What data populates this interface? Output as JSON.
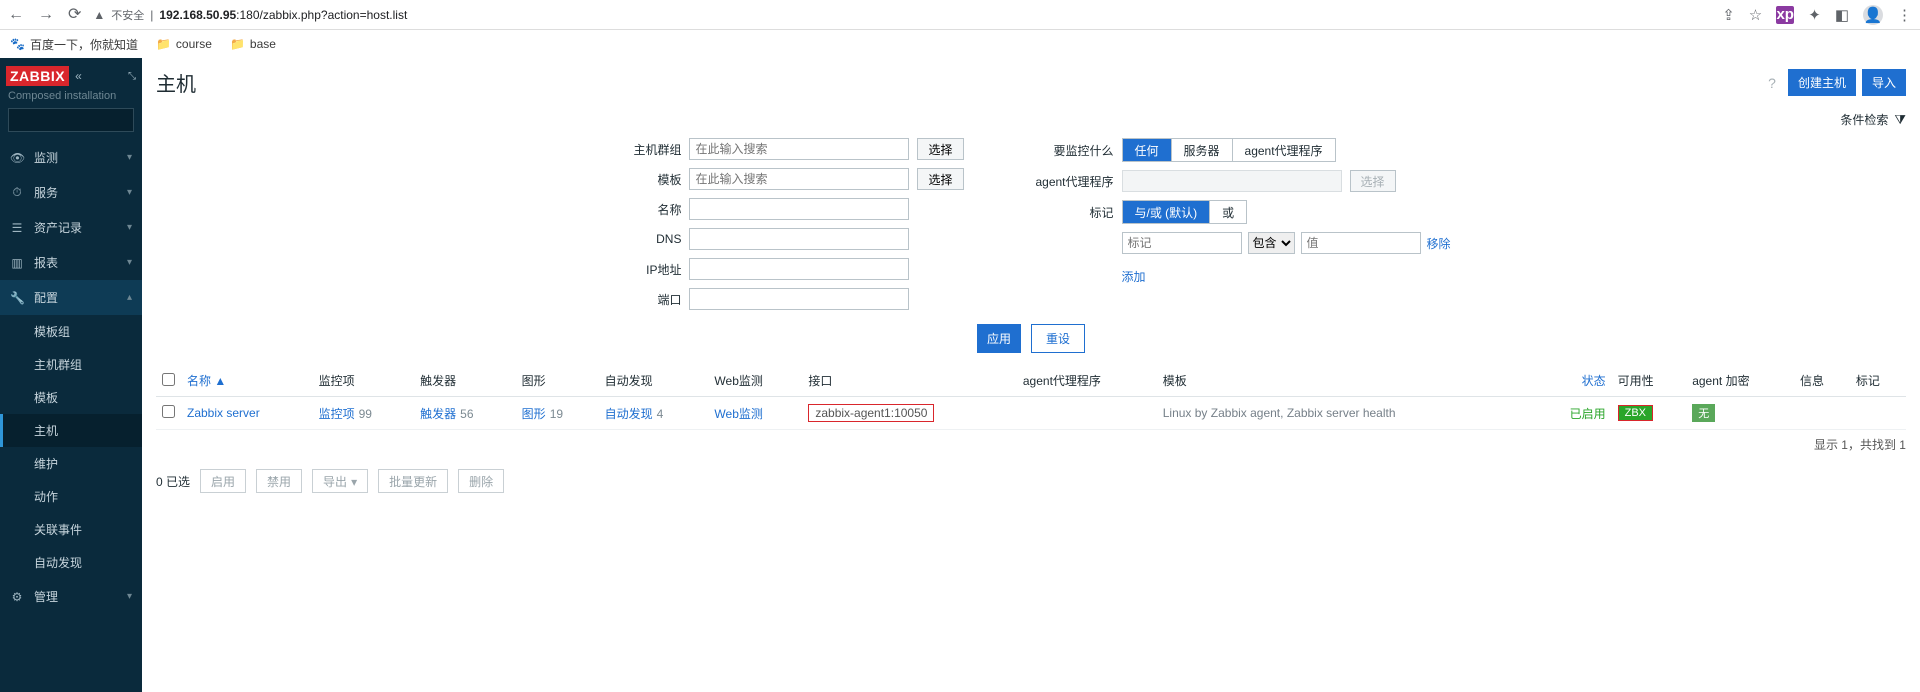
{
  "browser": {
    "insecure": "不安全",
    "url_host": "192.168.50.95",
    "url_rest": ":180/zabbix.php?action=host.list"
  },
  "bookmarks": {
    "baidu": "百度一下，你就知道",
    "course": "course",
    "base": "base"
  },
  "sidebar": {
    "logo": "ZABBIX",
    "installed": "Composed installation",
    "items": {
      "monitor": "监测",
      "services": "服务",
      "inventory": "资产记录",
      "reports": "报表",
      "config": "配置",
      "admin": "管理"
    },
    "config_sub": {
      "template_groups": "模板组",
      "host_groups": "主机群组",
      "templates": "模板",
      "hosts": "主机",
      "maintenance": "维护",
      "actions": "动作",
      "correlation": "关联事件",
      "discovery": "自动发现"
    }
  },
  "page": {
    "title": "主机",
    "create": "创建主机",
    "import": "导入",
    "filter_label": "条件检索"
  },
  "filter": {
    "left": {
      "host_group": "主机群组",
      "placeholder_search": "在此输入搜索",
      "select": "选择",
      "template": "模板",
      "name": "名称",
      "dns": "DNS",
      "ip": "IP地址",
      "port": "端口"
    },
    "right": {
      "monitor_what": "要监控什么",
      "any": "任何",
      "server": "服务器",
      "proxy": "agent代理程序",
      "proxy_label": "agent代理程序",
      "tag_label": "标记",
      "tag_andor": "与/或  (默认)",
      "tag_or": "或",
      "tag_placeholder": "标记",
      "contains": "包含",
      "value_placeholder": "值",
      "remove": "移除",
      "add": "添加"
    },
    "apply": "应用",
    "reset": "重设"
  },
  "table": {
    "headers": {
      "name": "名称",
      "items": "监控项",
      "triggers": "触发器",
      "graphs": "图形",
      "discovery": "自动发现",
      "web": "Web监测",
      "interface": "接口",
      "proxy": "agent代理程序",
      "template": "模板",
      "status": "状态",
      "availability": "可用性",
      "encryption": "agent 加密",
      "info": "信息",
      "tags": "标记"
    },
    "row": {
      "name": "Zabbix server",
      "items_label": "监控项",
      "items_count": "99",
      "triggers_label": "触发器",
      "triggers_count": "56",
      "graphs_label": "图形",
      "graphs_count": "19",
      "discovery_label": "自动发现",
      "discovery_count": "4",
      "web_label": "Web监测",
      "interface": "zabbix-agent1:10050",
      "templates": "Linux by Zabbix agent, Zabbix server health",
      "status": "已启用",
      "availability": "ZBX",
      "encryption": "无"
    },
    "paging": "显示 1，共找到 1"
  },
  "bulk": {
    "selected": "0 已选",
    "enable": "启用",
    "disable": "禁用",
    "export": "导出",
    "massupdate": "批量更新",
    "delete": "删除"
  }
}
